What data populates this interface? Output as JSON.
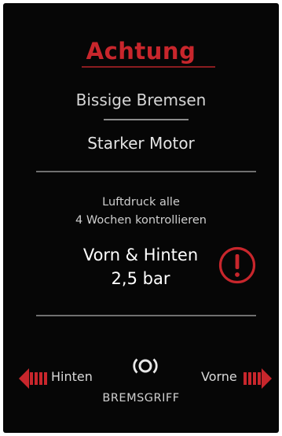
{
  "colors": {
    "accent": "#c0242b",
    "background": "#060606",
    "text": "#e0e0e0"
  },
  "header": {
    "title": "Achtung"
  },
  "warnings": {
    "line1": "Bissige Bremsen",
    "line2": "Starker Motor"
  },
  "tire_pressure": {
    "note_line1": "Luftdruck alle",
    "note_line2": "4 Wochen kontrollieren",
    "axle_label": "Vorn & Hinten",
    "value": "2,5 bar",
    "icon": "exclamation-circle-icon"
  },
  "navigation": {
    "back_label": "Hinten",
    "back_icon": "arrow-left-icon",
    "forward_label": "Vorne",
    "forward_icon": "arrow-right-icon",
    "brake_label": "BREMSGRIFF",
    "brake_icon": "brake-icon"
  }
}
